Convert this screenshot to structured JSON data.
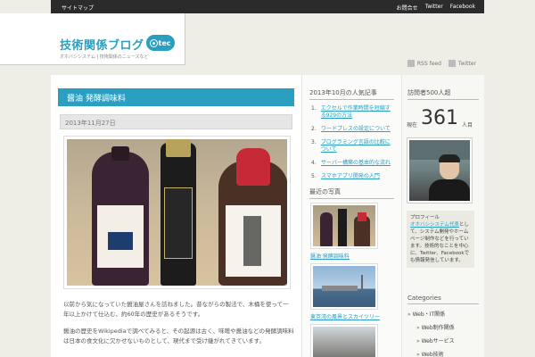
{
  "topbar": {
    "left": "サイトマップ",
    "right": [
      "お問合せ",
      "Twitter",
      "Facebook"
    ]
  },
  "logo": {
    "title": "技術関係ブログ",
    "tagline": "オホバシシステム | 技術関係のニュースなど",
    "badge": "tec"
  },
  "feeds": [
    "RSS feed",
    "Twitter"
  ],
  "post": {
    "title": "醤油 発酵調味料",
    "date": "2013年11月27日",
    "paragraphs": [
      "以前から気になっていた醤油屋さんを訪ねました。昔ながらの製法で、木桶を使って一年以上かけて仕込む、約60年の歴史があるそうです。",
      "醤油の歴史をWikipediaで調べてみると、その起源は古く、味噌や醤油などの発酵調味料は日本の食文化に欠かせないものとして、現代まで受け継がれてきています。"
    ]
  },
  "ranking": {
    "title": "2013年10月の人気記事",
    "items": [
      "エクセルで作業時間を短縮する929の方法",
      "ワードプレスの設定について",
      "プログラミング言語の比較について",
      "サーバー構築の基本的な流れ",
      "スマホアプリ開発の入門"
    ]
  },
  "recent": {
    "title": "最近の写真",
    "items": [
      {
        "caption": "醤油 発酵調味料"
      },
      {
        "caption": "東京湾の風景とスカイツリー"
      }
    ]
  },
  "visitor": {
    "title": "訪問者500人超",
    "prefix": "現在",
    "count": "361",
    "suffix": "人目"
  },
  "profile": {
    "heading": "プロフィール",
    "link": "オホバシシステム代表",
    "text": "として、システム開発やホームページ制作などを行っています。技術的なことを中心に、Twitter、Facebookでも情報発信しています。"
  },
  "categories": {
    "title": "Categories",
    "items": [
      {
        "label": "Web・IT関係",
        "sub": false
      },
      {
        "label": "Web制作関係",
        "sub": true
      },
      {
        "label": "Webサービス",
        "sub": true
      },
      {
        "label": "Web技術",
        "sub": true
      }
    ]
  },
  "colors": {
    "accent": "#2a9fc1",
    "topbar": "#2b2b2b",
    "background": "#efeee6"
  }
}
